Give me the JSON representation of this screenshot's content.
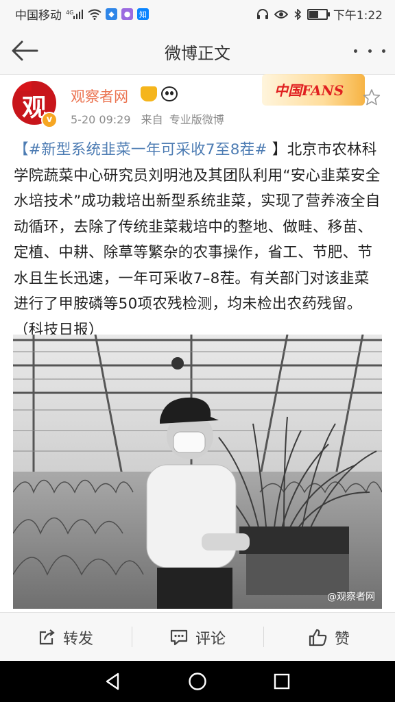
{
  "status_bar": {
    "carrier": "中国移动",
    "network": "4G",
    "time": "下午1:22",
    "battery_level": 0.55
  },
  "nav": {
    "title": "微博正文",
    "back_icon": "arrow-left-icon",
    "more_icon": "more-dots-icon"
  },
  "post": {
    "user_name": "观察者网",
    "avatar_text": "观",
    "timestamp": "5-20 09:29",
    "source_prefix": "来自",
    "source": "专业版微博",
    "fans_banner": "中国FANS",
    "hashtag": "【#新型系统韭菜一年可采收7至8茬#",
    "body": " 】北京市农林科学院蔬菜中心研究员刘明池及其团队利用“安心韭菜安全水培技术”成功栽培出新型系统韭菜，实现了营养液全自动循环，去除了传统韭菜栽培中的整地、做畦、移苗、定植、中耕、除草等繁杂的农事操作，省工、节肥、节水且生长迅速，一年可采收7–8茬。有关部门对该韭菜进行了甲胺磷等50项农残检测，均未检出农药残留。（科技日报）",
    "watermark": "@观察者网"
  },
  "actions": {
    "repost": "转发",
    "comment": "评论",
    "like": "赞"
  }
}
